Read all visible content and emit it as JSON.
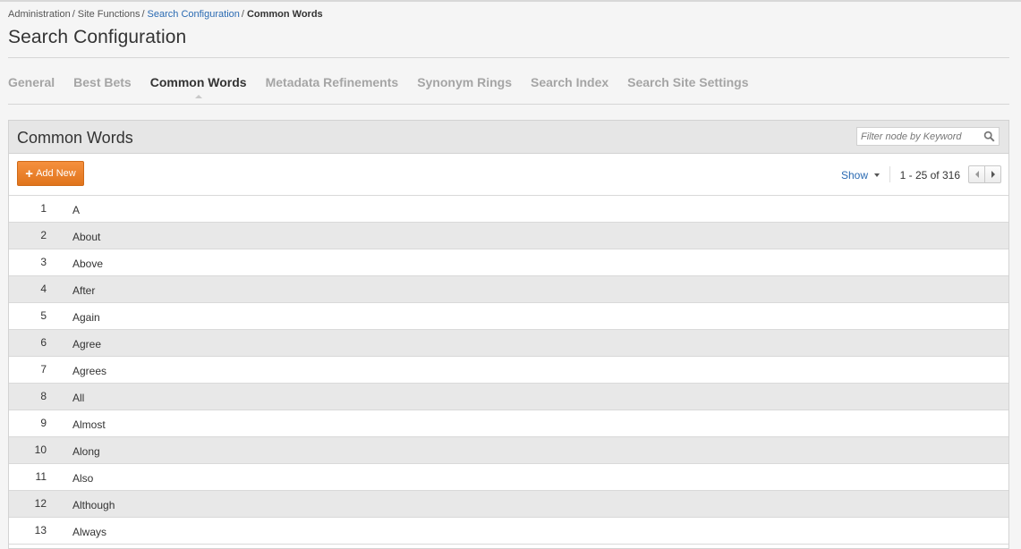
{
  "breadcrumb": {
    "items": [
      {
        "label": "Administration",
        "link": false
      },
      {
        "label": "Site Functions",
        "link": false
      },
      {
        "label": "Search Configuration",
        "link": true
      },
      {
        "label": "Common Words",
        "current": true
      }
    ],
    "separator": "/"
  },
  "page": {
    "title": "Search Configuration"
  },
  "tabs": [
    {
      "label": "General"
    },
    {
      "label": "Best Bets"
    },
    {
      "label": "Common Words",
      "active": true
    },
    {
      "label": "Metadata Refinements"
    },
    {
      "label": "Synonym Rings"
    },
    {
      "label": "Search Index"
    },
    {
      "label": "Search Site Settings"
    }
  ],
  "panel": {
    "title": "Common Words",
    "filter_placeholder": "Filter node by Keyword",
    "filter_value": "",
    "add_label": "Add New",
    "add_icon": "+",
    "show_label": "Show",
    "range_label": "1 - 25 of 316"
  },
  "words": [
    {
      "num": "1",
      "word": "A"
    },
    {
      "num": "2",
      "word": "About"
    },
    {
      "num": "3",
      "word": "Above"
    },
    {
      "num": "4",
      "word": "After"
    },
    {
      "num": "5",
      "word": "Again"
    },
    {
      "num": "6",
      "word": "Agree"
    },
    {
      "num": "7",
      "word": "Agrees"
    },
    {
      "num": "8",
      "word": "All"
    },
    {
      "num": "9",
      "word": "Almost"
    },
    {
      "num": "10",
      "word": "Along"
    },
    {
      "num": "11",
      "word": "Also"
    },
    {
      "num": "12",
      "word": "Although"
    },
    {
      "num": "13",
      "word": "Always"
    }
  ],
  "colors": {
    "accent_orange": "#e8801f",
    "link_blue": "#2a6ab2",
    "header_gray": "#e6e6e6",
    "row_alt": "#e8e8e8"
  }
}
